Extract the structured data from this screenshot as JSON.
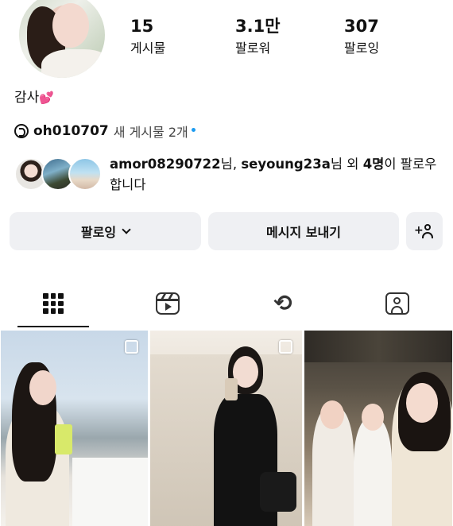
{
  "profile": {
    "bio_text": "감사",
    "bio_emoji": "💕",
    "stats": {
      "posts": {
        "count": "15",
        "label": "게시물"
      },
      "followers": {
        "count": "3.1만",
        "label": "팔로워"
      },
      "following": {
        "count": "307",
        "label": "팔로잉"
      }
    }
  },
  "threads": {
    "handle": "oh010707",
    "new_posts": "새 게시물 2개"
  },
  "mutual": {
    "user1": "amor08290722",
    "sep1": "님, ",
    "user2": "seyoung23a",
    "sep2": "님 외 ",
    "others": "4명",
    "suffix": "이 팔로우합니다"
  },
  "actions": {
    "following_label": "팔로잉",
    "message_label": "메시지 보내기",
    "adduser_plus": "+"
  },
  "tabs": [
    "grid-icon",
    "reels-icon",
    "repost-icon",
    "tagged-icon"
  ],
  "colors": {
    "button_bg": "#eff0f3",
    "threads_dot": "#1d9bf0",
    "heart": "#ff4fb8"
  }
}
